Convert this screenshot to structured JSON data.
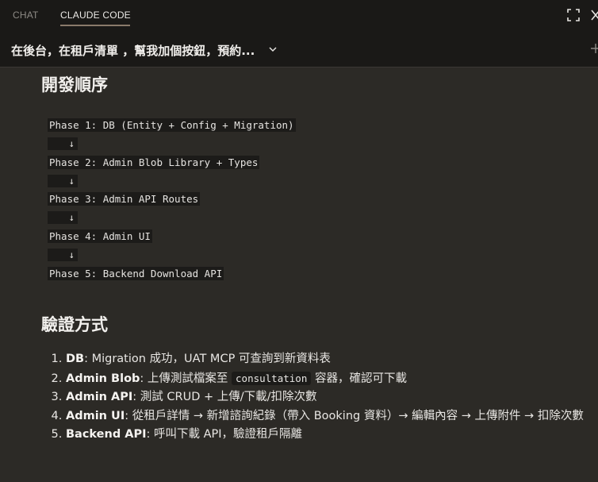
{
  "tabs": {
    "chat": "CHAT",
    "claude_code": "CLAUDE CODE"
  },
  "conversation": {
    "title": "在後台，在租戶清單 ，幫我加個按鈕，預約..."
  },
  "icons": {
    "expand": "expand-icon",
    "close": "close-icon",
    "chevron": "chevron-down-icon",
    "new_chat": "new-chat-icon"
  },
  "dev_order": {
    "heading": "開發順序",
    "phases": [
      "Phase 1: DB (Entity + Config + Migration)",
      "Phase 2: Admin Blob Library + Types",
      "Phase 3: Admin API Routes",
      "Phase 4: Admin UI",
      "Phase 5: Backend Download API"
    ],
    "arrow": "↓"
  },
  "verify": {
    "heading": "驗證方式",
    "items": [
      {
        "label": "DB",
        "text": ": Migration 成功，UAT MCP 可查詢到新資料表"
      },
      {
        "label": "Admin Blob",
        "text_before": ": 上傳測試檔案至 ",
        "code": "consultation",
        "text_after": " 容器，確認可下載"
      },
      {
        "label": "Admin API",
        "text": ": 測試 CRUD + 上傳/下載/扣除次數"
      },
      {
        "label": "Admin UI",
        "text": ": 從租戶詳情 → 新增諮詢紀錄（帶入 Booking 資料）→ 編輯內容 → 上傳附件 → 扣除次數"
      },
      {
        "label": "Backend API",
        "text": ": 呼叫下載 API，驗證租戶隔離"
      }
    ]
  },
  "colors": {
    "background": "#2c2a26",
    "header": "#1a1917",
    "code_bg": "#1c1b19",
    "accent_underline": "#8a7a6a"
  }
}
